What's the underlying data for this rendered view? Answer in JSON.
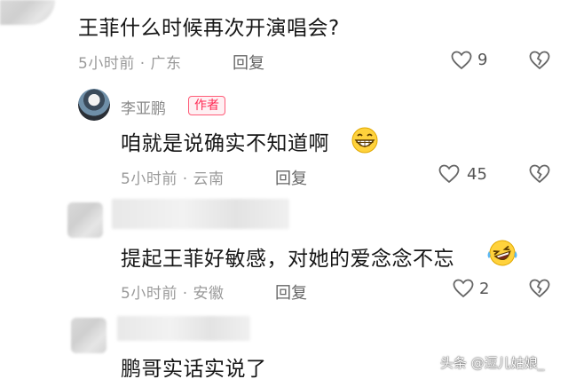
{
  "comments": [
    {
      "text": "王菲什么时候再次开演唱会?",
      "meta": "5小时前 · 广东",
      "reply_label": "回复",
      "likes": "9"
    },
    {
      "author": "李亚鹏",
      "badge": "作者",
      "text": "咱就是说确实不知道啊",
      "meta": "5小时前 · 云南",
      "reply_label": "回复",
      "likes": "45"
    },
    {
      "text": "提起王菲好敏感，对她的爱念念不忘",
      "meta": "5小时前 · 安徽",
      "reply_label": "回复",
      "likes": "2"
    },
    {
      "text": "鹏哥实话实说了"
    }
  ],
  "watermark": "头条 @逗儿姑娘_",
  "icons": {
    "like": "heart-outline-icon",
    "dislike": "broken-heart-icon",
    "emoji_grin": "grinning-emoji-icon",
    "emoji_laugh": "laughing-tears-emoji-icon"
  }
}
